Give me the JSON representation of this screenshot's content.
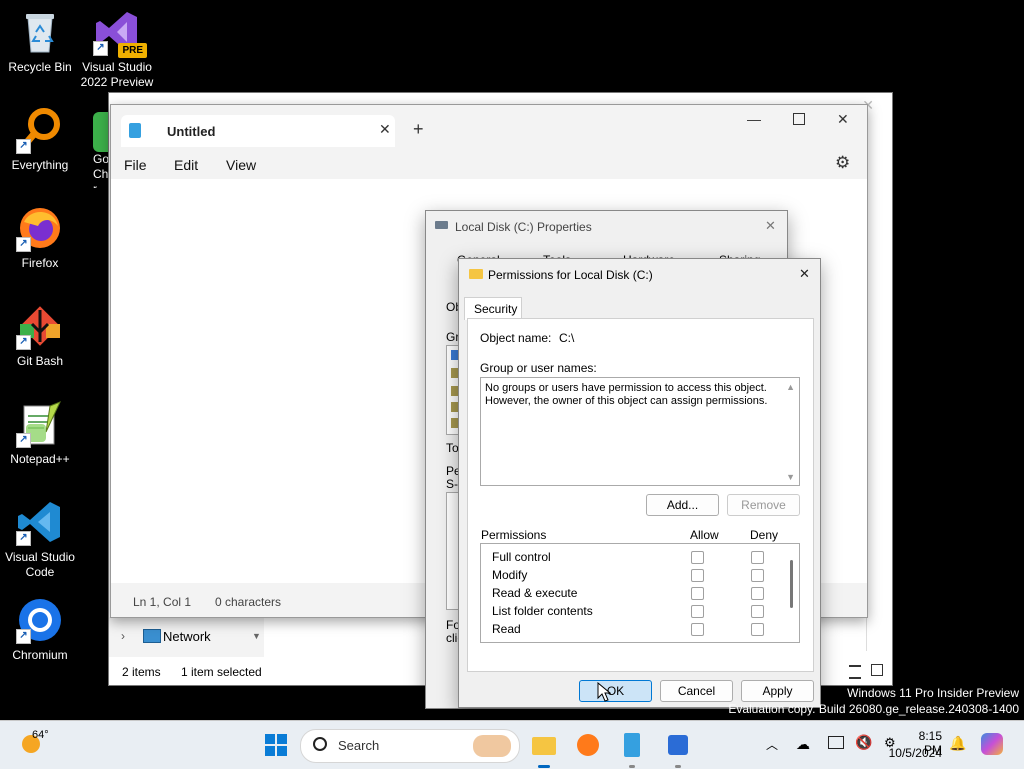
{
  "desktop": {
    "icons": [
      {
        "label": "Recycle Bin"
      },
      {
        "label": "Visual Studio 2022 Preview",
        "badge": "PRE"
      },
      {
        "label": "Everything"
      },
      {
        "label": "Firefox"
      },
      {
        "label": "Git Bash"
      },
      {
        "label": "Notepad++"
      },
      {
        "label": "Visual Studio Code"
      },
      {
        "label": "Chromium"
      }
    ],
    "partial_icon_label": "Go Chr",
    "watermark_line1": "Windows 11 Pro Insider Preview",
    "watermark_line2": "Evaluation copy. Build 26080.ge_release.240308-1400"
  },
  "explorer": {
    "nav_network": "Network",
    "status_items": "2 items",
    "status_selected": "1 item selected"
  },
  "notepad": {
    "tab_title": "Untitled",
    "menu": [
      "File",
      "Edit",
      "View"
    ],
    "status_pos": "Ln 1, Col 1",
    "status_chars": "0 characters"
  },
  "properties": {
    "title": "Local Disk (C:) Properties",
    "tabs": [
      "General",
      "Tools",
      "Hardware",
      "Sharing"
    ],
    "cut_labels": [
      "Ob",
      "Gro",
      "To",
      "Pe",
      "S-",
      "Fo",
      "clic"
    ]
  },
  "permissions": {
    "title": "Permissions for Local Disk (C:)",
    "tab": "Security",
    "object_name_label": "Object name:",
    "object_name_value": "C:\\",
    "group_label": "Group or user names:",
    "group_message_1": "No groups or users have permission to access this object.",
    "group_message_2": "However, the owner of this object can assign permissions.",
    "add_label": "Add...",
    "remove_label": "Remove",
    "perm_header": "Permissions",
    "allow_header": "Allow",
    "deny_header": "Deny",
    "perms": [
      "Full control",
      "Modify",
      "Read & execute",
      "List folder contents",
      "Read"
    ],
    "ok_label": "OK",
    "cancel_label": "Cancel",
    "apply_label": "Apply"
  },
  "taskbar": {
    "weather_temp": "64°",
    "search_placeholder": "Search",
    "time": "8:15 PM",
    "date": "10/5/2024"
  },
  "colors": {
    "accent": "#0067c0",
    "ok_button_bg": "#cce4f7",
    "ok_button_border": "#0078d4"
  }
}
